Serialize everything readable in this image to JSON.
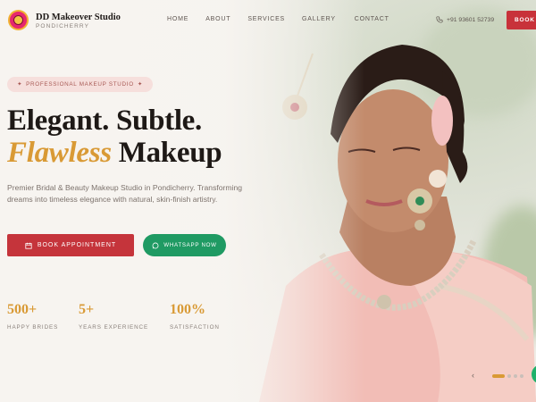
{
  "brand": {
    "name": "DD Makeover Studio",
    "location": "PONDICHERRY"
  },
  "nav": {
    "links": [
      "HOME",
      "ABOUT",
      "SERVICES",
      "GALLERY",
      "CONTACT"
    ],
    "phone": "+91 93601 52739",
    "book_label": "BOOK"
  },
  "hero": {
    "badge": "PROFESSIONAL MAKEUP STUDIO",
    "heading_line1": "Elegant. Subtle.",
    "heading_highlight": "Flawless",
    "heading_rest": " Makeup",
    "description": "Premier Bridal & Beauty Makeup Studio in Pondicherry. Transforming dreams into timeless elegance with natural, skin-finish artistry.",
    "book_button": "BOOK APPOINTMENT",
    "whatsapp_button": "WHATSAPP NOW"
  },
  "stats": [
    {
      "value": "500+",
      "label": "HAPPY BRIDES"
    },
    {
      "value": "5+",
      "label": "YEARS EXPERIENCE"
    },
    {
      "value": "100%",
      "label": "SATISFACTION"
    }
  ],
  "slider": {
    "slides": 4,
    "active_index": 0,
    "prev_icon": "chevron-left-icon"
  },
  "colors": {
    "accent_red": "#c5343b",
    "gold": "#d99a35",
    "whatsapp_green": "#1f9a63",
    "badge_bg": "#f6dfdc"
  }
}
